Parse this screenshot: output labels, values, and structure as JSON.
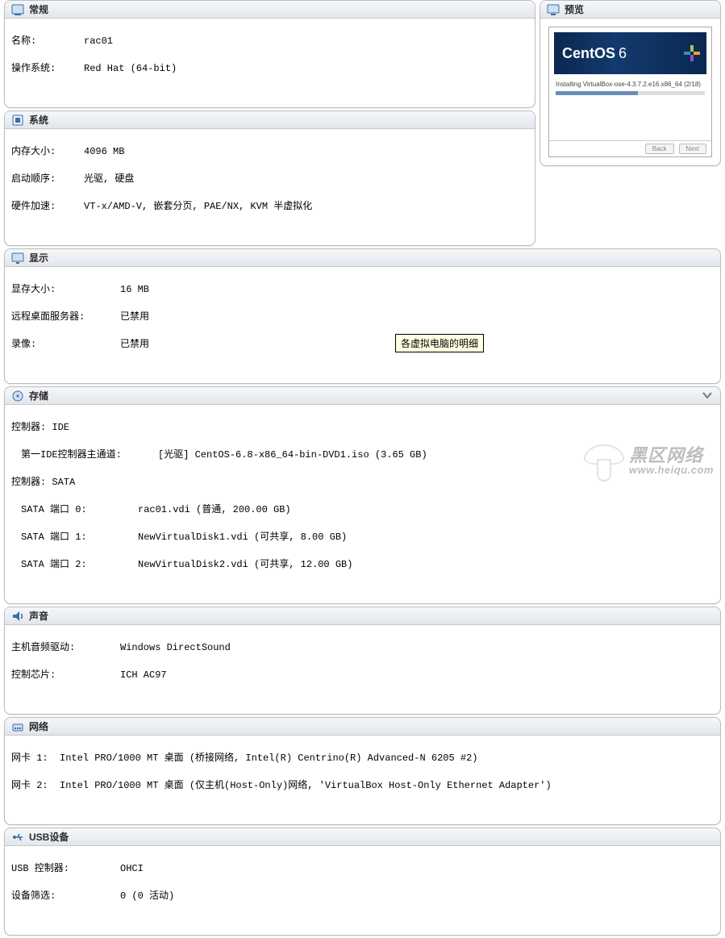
{
  "sections": {
    "general": {
      "title": "常规",
      "name_lbl": "名称:",
      "name_val": "rac01",
      "os_lbl": "操作系统:",
      "os_val": "Red Hat (64-bit)"
    },
    "system": {
      "title": "系统",
      "mem_lbl": "内存大小:",
      "mem_val": "4096 MB",
      "boot_lbl": "启动顺序:",
      "boot_val": "光驱, 硬盘",
      "accel_lbl": "硬件加速:",
      "accel_val": "VT-x/AMD-V, 嵌套分页, PAE/NX, KVM 半虚拟化"
    },
    "display": {
      "title": "显示",
      "vmem_lbl": "显存大小:",
      "vmem_val": "16 MB",
      "rdp_lbl": "远程桌面服务器:",
      "rdp_val": "已禁用",
      "rec_lbl": "录像:",
      "rec_val": "已禁用"
    },
    "storage": {
      "title": "存储",
      "ctl_ide_lbl": "控制器: IDE",
      "ide_ch_lbl": "第一IDE控制器主通道:",
      "ide_ch_val": "[光驱] CentOS-6.8-x86_64-bin-DVD1.iso (3.65 GB)",
      "ctl_sata_lbl": "控制器: SATA",
      "sata0_lbl": "SATA 端口 0:",
      "sata0_val": "rac01.vdi (普通, 200.00 GB)",
      "sata1_lbl": "SATA 端口 1:",
      "sata1_val": "NewVirtualDisk1.vdi (可共享, 8.00 GB)",
      "sata2_lbl": "SATA 端口 2:",
      "sata2_val": "NewVirtualDisk2.vdi (可共享, 12.00 GB)"
    },
    "audio": {
      "title": "声音",
      "drv_lbl": "主机音频驱动:",
      "drv_val": "Windows DirectSound",
      "chip_lbl": "控制芯片:",
      "chip_val": "ICH AC97"
    },
    "network": {
      "title": "网络",
      "n1_lbl": "网卡 1:",
      "n1_val": "Intel PRO/1000 MT 桌面 (桥接网络, Intel(R) Centrino(R) Advanced-N 6205 #2)",
      "n2_lbl": "网卡 2:",
      "n2_val": "Intel PRO/1000 MT 桌面 (仅主机(Host-Only)网络, 'VirtualBox Host-Only Ethernet Adapter')"
    },
    "usb": {
      "title": "USB设备",
      "ctl_lbl": "USB 控制器:",
      "ctl_val": "OHCI",
      "flt_lbl": "设备筛选:",
      "flt_val": "0 (0 活动)"
    },
    "preview": {
      "title": "预览",
      "centos_brand": "CentOS",
      "centos_ver": "6",
      "install_line": "Installing VirtualBox-ose-4.3.7.2.e16.x86_64 (2/18)",
      "btn_back": "Back",
      "btn_next": "Next"
    }
  },
  "tooltip": "各虚拟电脑的明细",
  "watermark": {
    "cn": "黑区网络",
    "en": "www.heiqu.com"
  }
}
